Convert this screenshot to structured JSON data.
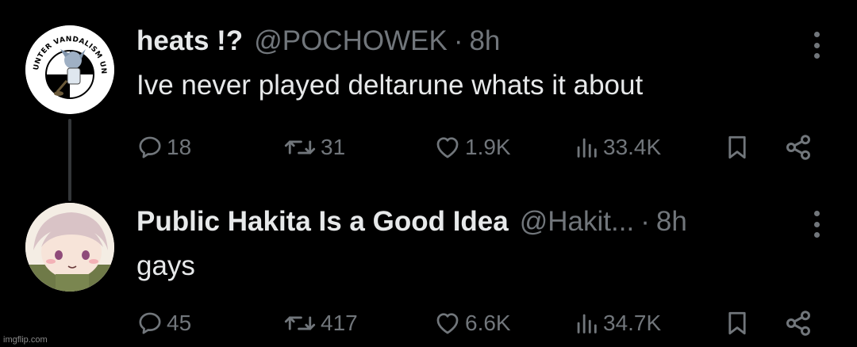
{
  "tweets": [
    {
      "name": "heats !?",
      "handle": "@POCHOWEK",
      "separator": "·",
      "time": "8h",
      "text": "Ive never played deltarune whats it about",
      "avatar_text": "COUNTER VANDALISM UNIT",
      "stats": {
        "replies": "18",
        "retweets": "31",
        "likes": "1.9K",
        "views": "33.4K"
      }
    },
    {
      "name": "Public Hakita Is a Good Idea",
      "handle": "@Hakit...",
      "separator": "·",
      "time": "8h",
      "text": "gays",
      "stats": {
        "replies": "45",
        "retweets": "417",
        "likes": "6.6K",
        "views": "34.7K"
      }
    }
  ],
  "watermark": "imgflip.com",
  "icons": [
    "reply-icon",
    "retweet-icon",
    "like-icon",
    "views-icon",
    "bookmark-icon",
    "share-icon",
    "more-options-icon"
  ],
  "colors": {
    "background": "#000000",
    "text": "#e7e9ea",
    "muted": "#71767b",
    "thread_line": "#333639"
  }
}
